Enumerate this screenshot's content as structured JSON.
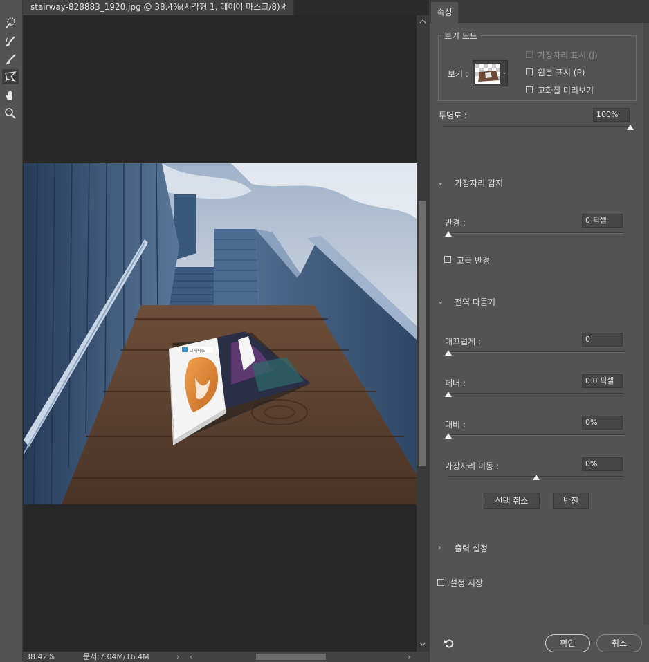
{
  "document": {
    "tab_title": "stairway-828883_1920.jpg @ 38.4%(사각형 1, 레이어 마스크/8) *",
    "close_glyph": "×"
  },
  "status": {
    "zoom": "38.42%",
    "doc_size": "문서:7.04M/16.4M",
    "arrow_right": "›",
    "arrow_left": "‹",
    "arrow_end": "›"
  },
  "book": {
    "brand": "그래픽스"
  },
  "tools": [
    {
      "name": "quick-selection-icon"
    },
    {
      "name": "refine-edge-brush-icon"
    },
    {
      "name": "brush-icon"
    },
    {
      "name": "lasso-icon"
    },
    {
      "name": "hand-icon"
    },
    {
      "name": "zoom-icon"
    }
  ],
  "panel": {
    "tab_label": "속성",
    "view_mode": {
      "title": "보기 모드",
      "view_label": "보기 :",
      "show_edge": "가장자리 표시 (J)",
      "show_original": "원본 표시 (P)",
      "hq_preview": "고화질 미리보기"
    },
    "opacity": {
      "label": "투명도 :",
      "value": "100%",
      "level": 1.0
    },
    "edge_detection": {
      "title": "가장자리 감지",
      "radius_label": "반경 :",
      "radius_value": "0 픽셀",
      "smart_radius": "고급 반경"
    },
    "global_refine": {
      "title": "전역 다듬기",
      "smooth_label": "매끄럽게 :",
      "smooth_value": "0",
      "feather_label": "페더 :",
      "feather_value": "0.0 픽셀",
      "contrast_label": "대비 :",
      "contrast_value": "0%",
      "shift_label": "가장자리 이동 :",
      "shift_value": "0%",
      "clear_selection": "선택 취소",
      "invert": "반전"
    },
    "output": {
      "title": "출력 설정"
    },
    "remember": "설정 저장",
    "ok": "확인",
    "cancel": "취소"
  },
  "colors": {
    "panel_bg": "#535353",
    "canvas_bg": "#282828",
    "toolbar_bg": "#535353"
  }
}
